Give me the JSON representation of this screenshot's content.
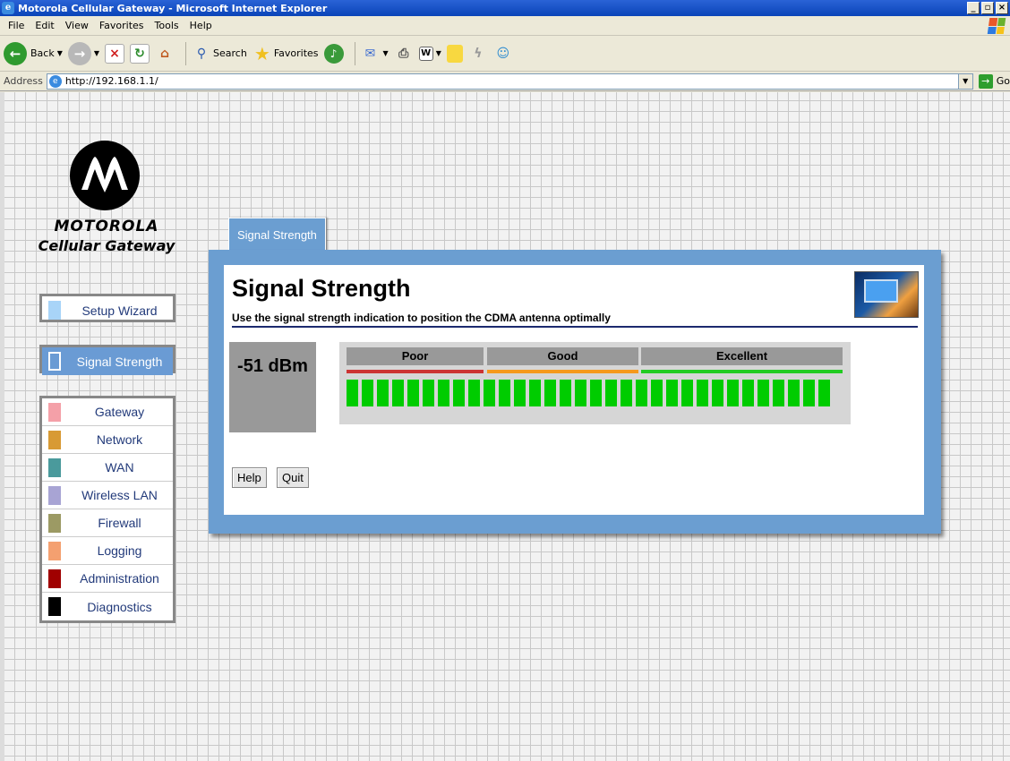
{
  "window": {
    "title": "Motorola Cellular Gateway - Microsoft Internet Explorer"
  },
  "menu": [
    "File",
    "Edit",
    "View",
    "Favorites",
    "Tools",
    "Help"
  ],
  "toolbar": {
    "back": "Back",
    "search": "Search",
    "favorites": "Favorites"
  },
  "address": {
    "label": "Address",
    "url": "http://192.168.1.1/",
    "go": "Go"
  },
  "brand": {
    "name": "MOTOROLA",
    "product": "Cellular Gateway"
  },
  "nav": {
    "setup": {
      "label": "Setup Wizard",
      "color": "#a8d4f8"
    },
    "signal": {
      "label": "Signal Strength",
      "color": "#6a9bd4"
    },
    "items": [
      {
        "label": "Gateway",
        "color": "#f4a0a8"
      },
      {
        "label": "Network",
        "color": "#d89a34"
      },
      {
        "label": "WAN",
        "color": "#4a9a9c"
      },
      {
        "label": "Wireless LAN",
        "color": "#a8a4d4"
      },
      {
        "label": "Firewall",
        "color": "#9c9a64"
      },
      {
        "label": "Logging",
        "color": "#f4a070"
      },
      {
        "label": "Administration",
        "color": "#a00000"
      },
      {
        "label": "Diagnostics",
        "color": "#000000"
      }
    ]
  },
  "tab": {
    "label": "Signal Strength"
  },
  "page": {
    "title": "Signal Strength",
    "subtitle": "Use the signal strength indication to position the CDMA antenna optimally",
    "reading": "-51 dBm",
    "meter": {
      "levels": [
        {
          "label": "Poor",
          "color": "#cc3333"
        },
        {
          "label": "Good",
          "color": "#f5991c"
        },
        {
          "label": "Excellent",
          "color": "#22cc22"
        }
      ],
      "bars_lit": 32,
      "bars_total": 32,
      "bar_color": "#00cc00"
    },
    "buttons": {
      "help": "Help",
      "quit": "Quit"
    }
  }
}
